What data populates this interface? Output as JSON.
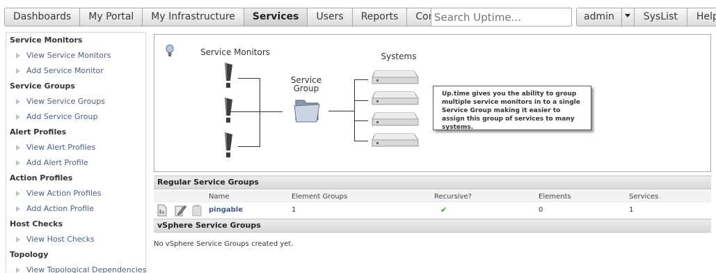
{
  "nav": {
    "tabs": [
      {
        "label": "Dashboards",
        "active": false
      },
      {
        "label": "My Portal",
        "active": false
      },
      {
        "label": "My Infrastructure",
        "active": false
      },
      {
        "label": "Services",
        "active": true
      },
      {
        "label": "Users",
        "active": false
      },
      {
        "label": "Reports",
        "active": false
      },
      {
        "label": "Config",
        "active": false
      }
    ],
    "search_placeholder": "Search Uptime...",
    "user_label": "admin",
    "syslist_label": "SysList",
    "help_label": "Help"
  },
  "sidebar": {
    "sections": [
      {
        "title": "Service Monitors",
        "links": [
          "View Service Monitors",
          "Add Service Monitor"
        ]
      },
      {
        "title": "Service Groups",
        "links": [
          "View Service Groups",
          "Add Service Group"
        ]
      },
      {
        "title": "Alert Profiles",
        "links": [
          "View Alert Profiles",
          "Add Alert Profile"
        ]
      },
      {
        "title": "Action Profiles",
        "links": [
          "View Action Profiles",
          "Add Action Profile"
        ]
      },
      {
        "title": "Host Checks",
        "links": [
          "View Host Checks"
        ]
      },
      {
        "title": "Topology",
        "links": [
          "View Topological Dependencies"
        ]
      }
    ]
  },
  "diagram": {
    "service_monitors_label": "Service Monitors",
    "service_group_label_line1": "Service",
    "service_group_label_line2": "Group",
    "systems_label": "Systems",
    "callout_text": "Up.time gives you the ability to group multiple service monitors in to a single Service Group making it easier to assign this group of services to many systems."
  },
  "regular_groups": {
    "title": "Regular Service Groups",
    "columns": [
      "Name",
      "Element Groups",
      "Recursive?",
      "Elements",
      "Services"
    ],
    "rows": [
      {
        "name": "pingable",
        "element_groups": "1",
        "recursive": "✔",
        "elements": "0",
        "services": "1"
      }
    ]
  },
  "vsphere_groups": {
    "title": "vSphere Service Groups",
    "empty_message": "No vSphere Service Groups created yet."
  },
  "colors": {
    "link": "#4a5f80",
    "check_green": "#3a9a2a"
  }
}
